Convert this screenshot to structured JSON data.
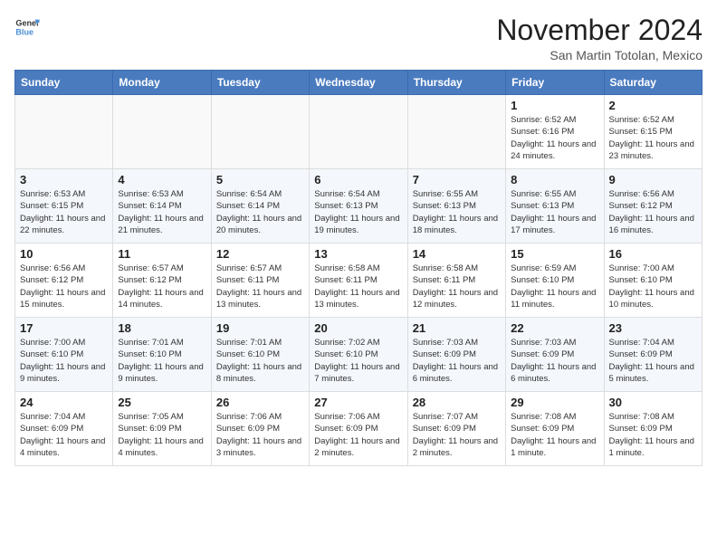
{
  "header": {
    "logo_general": "General",
    "logo_blue": "Blue",
    "month_title": "November 2024",
    "location": "San Martin Totolan, Mexico"
  },
  "calendar": {
    "days_of_week": [
      "Sunday",
      "Monday",
      "Tuesday",
      "Wednesday",
      "Thursday",
      "Friday",
      "Saturday"
    ],
    "weeks": [
      [
        {
          "day": "",
          "info": ""
        },
        {
          "day": "",
          "info": ""
        },
        {
          "day": "",
          "info": ""
        },
        {
          "day": "",
          "info": ""
        },
        {
          "day": "",
          "info": ""
        },
        {
          "day": "1",
          "info": "Sunrise: 6:52 AM\nSunset: 6:16 PM\nDaylight: 11 hours and 24 minutes."
        },
        {
          "day": "2",
          "info": "Sunrise: 6:52 AM\nSunset: 6:15 PM\nDaylight: 11 hours and 23 minutes."
        }
      ],
      [
        {
          "day": "3",
          "info": "Sunrise: 6:53 AM\nSunset: 6:15 PM\nDaylight: 11 hours and 22 minutes."
        },
        {
          "day": "4",
          "info": "Sunrise: 6:53 AM\nSunset: 6:14 PM\nDaylight: 11 hours and 21 minutes."
        },
        {
          "day": "5",
          "info": "Sunrise: 6:54 AM\nSunset: 6:14 PM\nDaylight: 11 hours and 20 minutes."
        },
        {
          "day": "6",
          "info": "Sunrise: 6:54 AM\nSunset: 6:13 PM\nDaylight: 11 hours and 19 minutes."
        },
        {
          "day": "7",
          "info": "Sunrise: 6:55 AM\nSunset: 6:13 PM\nDaylight: 11 hours and 18 minutes."
        },
        {
          "day": "8",
          "info": "Sunrise: 6:55 AM\nSunset: 6:13 PM\nDaylight: 11 hours and 17 minutes."
        },
        {
          "day": "9",
          "info": "Sunrise: 6:56 AM\nSunset: 6:12 PM\nDaylight: 11 hours and 16 minutes."
        }
      ],
      [
        {
          "day": "10",
          "info": "Sunrise: 6:56 AM\nSunset: 6:12 PM\nDaylight: 11 hours and 15 minutes."
        },
        {
          "day": "11",
          "info": "Sunrise: 6:57 AM\nSunset: 6:12 PM\nDaylight: 11 hours and 14 minutes."
        },
        {
          "day": "12",
          "info": "Sunrise: 6:57 AM\nSunset: 6:11 PM\nDaylight: 11 hours and 13 minutes."
        },
        {
          "day": "13",
          "info": "Sunrise: 6:58 AM\nSunset: 6:11 PM\nDaylight: 11 hours and 13 minutes."
        },
        {
          "day": "14",
          "info": "Sunrise: 6:58 AM\nSunset: 6:11 PM\nDaylight: 11 hours and 12 minutes."
        },
        {
          "day": "15",
          "info": "Sunrise: 6:59 AM\nSunset: 6:10 PM\nDaylight: 11 hours and 11 minutes."
        },
        {
          "day": "16",
          "info": "Sunrise: 7:00 AM\nSunset: 6:10 PM\nDaylight: 11 hours and 10 minutes."
        }
      ],
      [
        {
          "day": "17",
          "info": "Sunrise: 7:00 AM\nSunset: 6:10 PM\nDaylight: 11 hours and 9 minutes."
        },
        {
          "day": "18",
          "info": "Sunrise: 7:01 AM\nSunset: 6:10 PM\nDaylight: 11 hours and 9 minutes."
        },
        {
          "day": "19",
          "info": "Sunrise: 7:01 AM\nSunset: 6:10 PM\nDaylight: 11 hours and 8 minutes."
        },
        {
          "day": "20",
          "info": "Sunrise: 7:02 AM\nSunset: 6:10 PM\nDaylight: 11 hours and 7 minutes."
        },
        {
          "day": "21",
          "info": "Sunrise: 7:03 AM\nSunset: 6:09 PM\nDaylight: 11 hours and 6 minutes."
        },
        {
          "day": "22",
          "info": "Sunrise: 7:03 AM\nSunset: 6:09 PM\nDaylight: 11 hours and 6 minutes."
        },
        {
          "day": "23",
          "info": "Sunrise: 7:04 AM\nSunset: 6:09 PM\nDaylight: 11 hours and 5 minutes."
        }
      ],
      [
        {
          "day": "24",
          "info": "Sunrise: 7:04 AM\nSunset: 6:09 PM\nDaylight: 11 hours and 4 minutes."
        },
        {
          "day": "25",
          "info": "Sunrise: 7:05 AM\nSunset: 6:09 PM\nDaylight: 11 hours and 4 minutes."
        },
        {
          "day": "26",
          "info": "Sunrise: 7:06 AM\nSunset: 6:09 PM\nDaylight: 11 hours and 3 minutes."
        },
        {
          "day": "27",
          "info": "Sunrise: 7:06 AM\nSunset: 6:09 PM\nDaylight: 11 hours and 2 minutes."
        },
        {
          "day": "28",
          "info": "Sunrise: 7:07 AM\nSunset: 6:09 PM\nDaylight: 11 hours and 2 minutes."
        },
        {
          "day": "29",
          "info": "Sunrise: 7:08 AM\nSunset: 6:09 PM\nDaylight: 11 hours and 1 minute."
        },
        {
          "day": "30",
          "info": "Sunrise: 7:08 AM\nSunset: 6:09 PM\nDaylight: 11 hours and 1 minute."
        }
      ]
    ]
  }
}
